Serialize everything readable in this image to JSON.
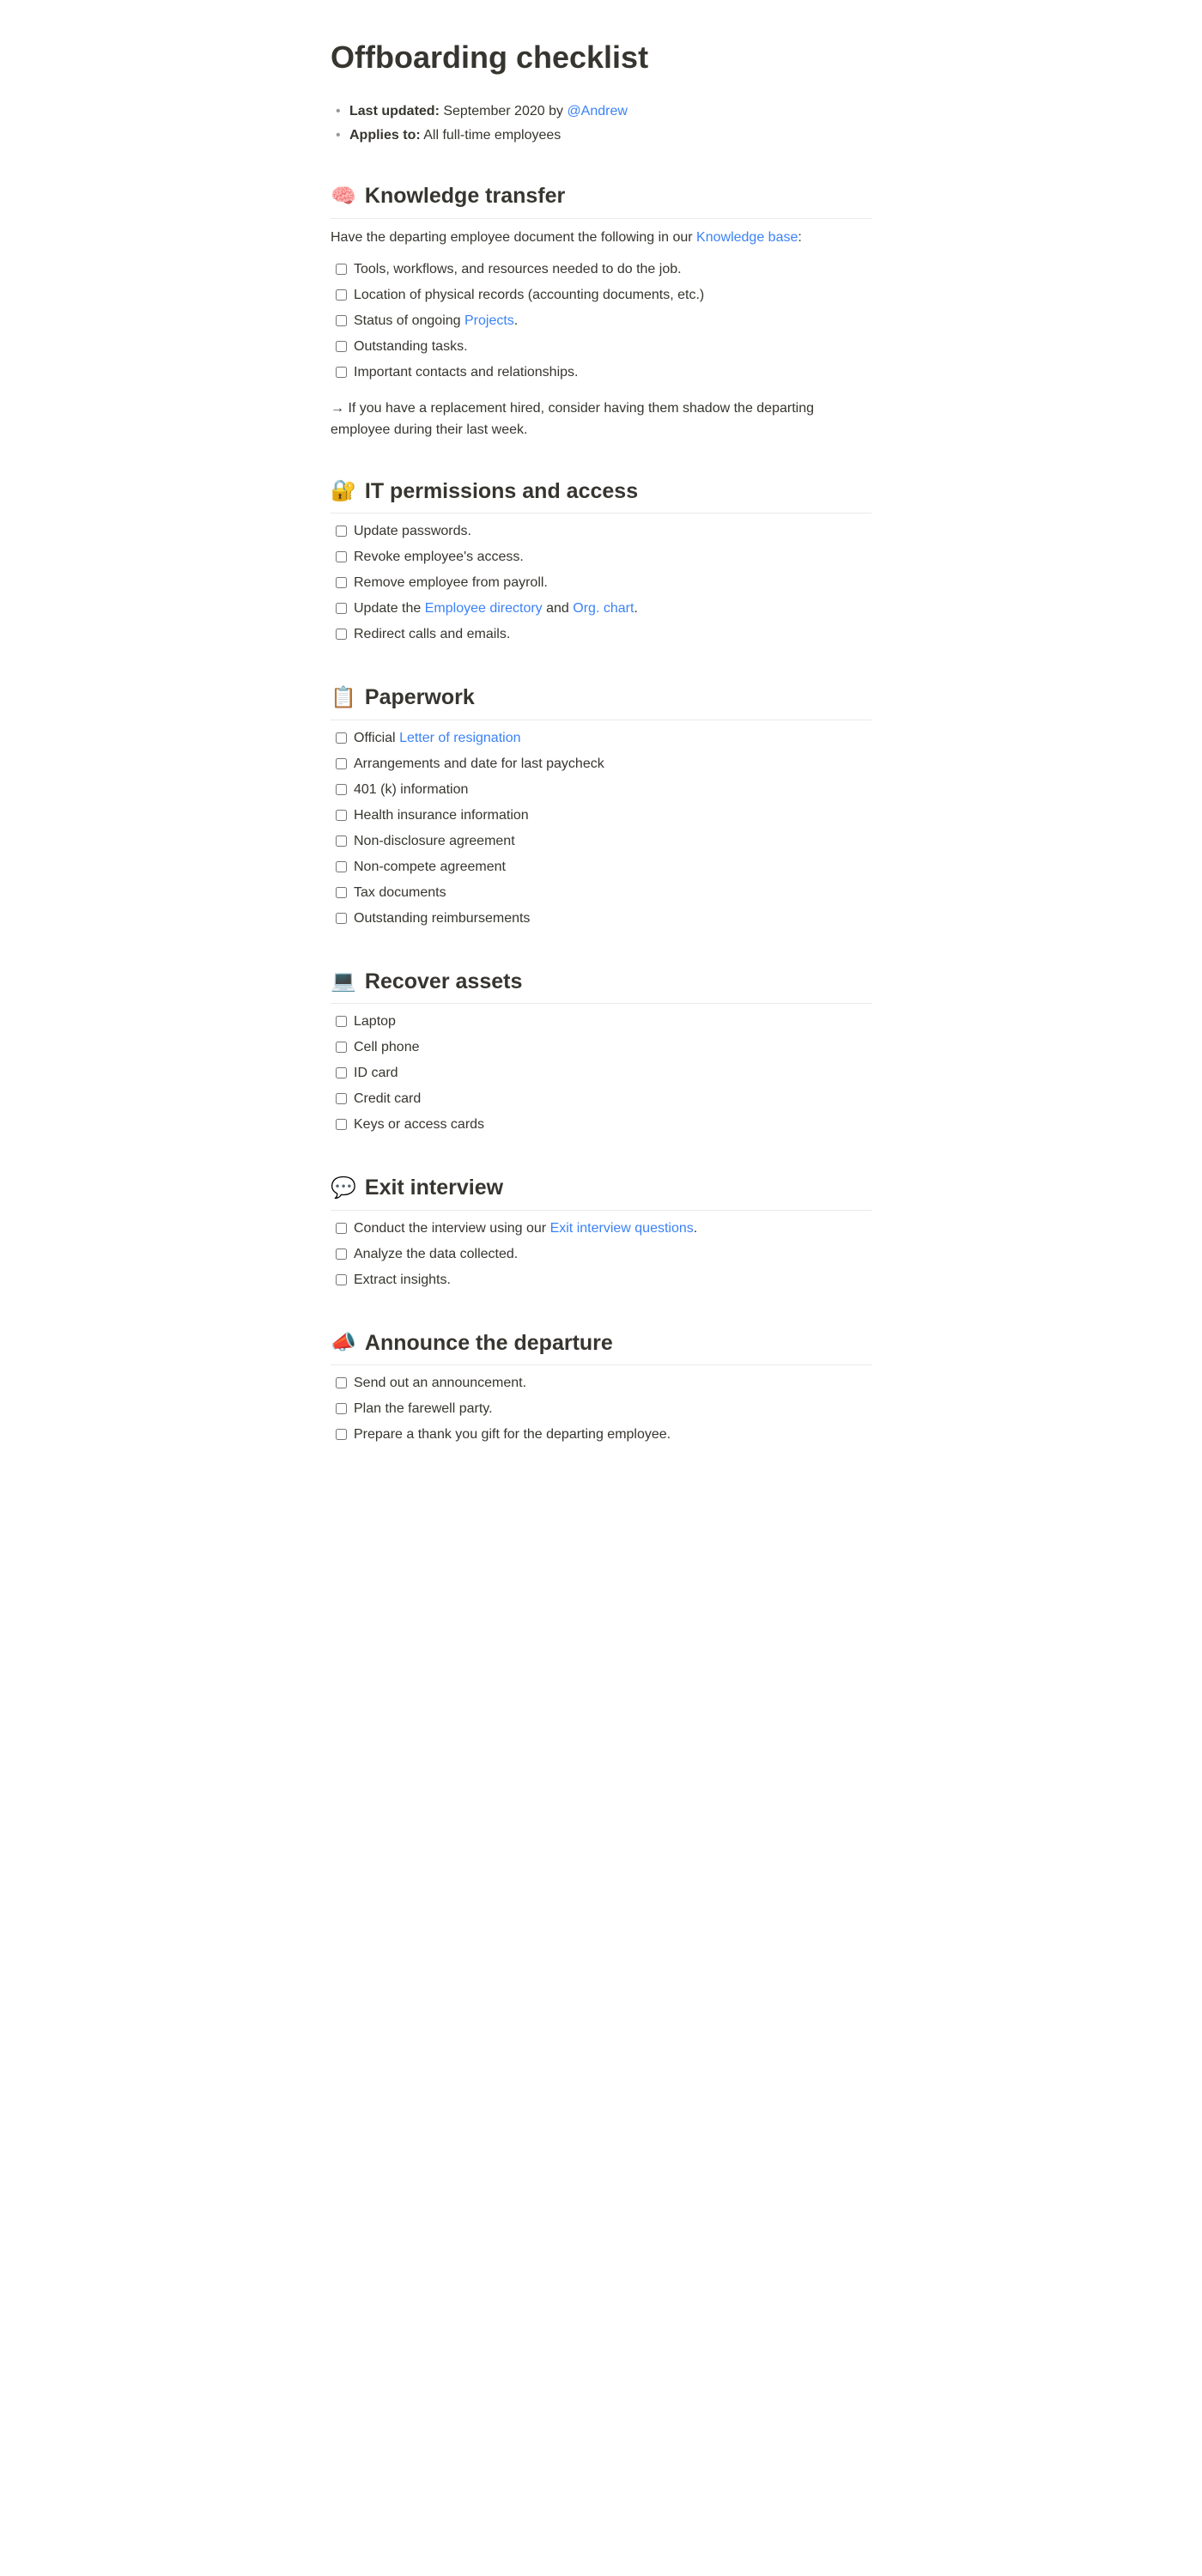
{
  "title": "Offboarding checklist",
  "meta": {
    "last_updated_label": "Last updated:",
    "last_updated_value": " September 2020 by ",
    "last_updated_author": "@Andrew",
    "applies_to_label": "Applies to:",
    "applies_to_value": " All full-time employees"
  },
  "sections": {
    "knowledge": {
      "emoji": "🧠",
      "heading": "Knowledge transfer",
      "intro_pre": "Have the departing employee document  the following in our ",
      "intro_link": "Knowledge base",
      "intro_post": ":",
      "items": [
        "Tools, workflows, and resources needed to do the job.",
        "Location of physical records (accounting documents, etc.)",
        "",
        "Outstanding tasks.",
        "Important contacts and relationships."
      ],
      "item2_pre": "Status of ongoing ",
      "item2_link": "Projects",
      "item2_post": ".",
      "note": "→ If you have a replacement hired, consider having them shadow the departing employee during their last week."
    },
    "it": {
      "emoji": "🔐",
      "heading": "IT permissions and access",
      "items": [
        "Update passwords.",
        "Revoke employee's access.",
        "Remove employee from payroll.",
        "",
        "Redirect calls and emails."
      ],
      "item3_pre": "Update the ",
      "item3_link1": "Employee directory",
      "item3_mid": " and ",
      "item3_link2": "Org. chart",
      "item3_post": "."
    },
    "paperwork": {
      "emoji": "📋",
      "heading": "Paperwork",
      "item0_pre": "Official ",
      "item0_link": "Letter of resignation",
      "items": [
        "",
        "Arrangements and date for last paycheck",
        "401 (k) information",
        "Health insurance information",
        "Non-disclosure agreement",
        "Non-compete agreement",
        "Tax documents",
        "Outstanding reimbursements"
      ]
    },
    "assets": {
      "emoji": "💻",
      "heading": "Recover assets",
      "items": [
        "Laptop",
        "Cell phone",
        "ID card",
        "Credit card",
        "Keys or access cards"
      ]
    },
    "exit": {
      "emoji": "💬",
      "heading": "Exit interview",
      "item0_pre": "Conduct the interview using our ",
      "item0_link": "Exit interview questions",
      "item0_post": ".",
      "items": [
        "",
        "Analyze the data collected.",
        "Extract insights."
      ]
    },
    "announce": {
      "emoji": "📣",
      "heading": "Announce the departure",
      "items": [
        "Send out an announcement.",
        "Plan the farewell party.",
        "Prepare a thank you gift for the departing employee."
      ]
    }
  }
}
